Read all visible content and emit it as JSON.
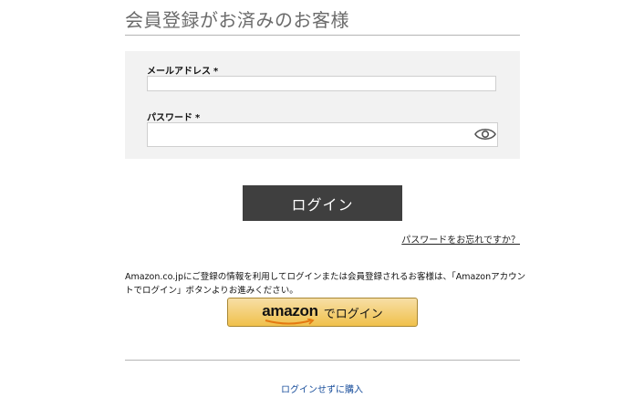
{
  "page": {
    "heading": "会員登録がお済みのお客様"
  },
  "form": {
    "email_label": "メールアドレス",
    "password_label": "パスワード",
    "required_mark": "*",
    "email_value": "",
    "password_value": ""
  },
  "login_button": "ログイン",
  "forgot_password": "パスワードをお忘れですか？",
  "amazon": {
    "description": "Amazon.co.jpにご登録の情報を利用してログインまたは会員登録されるお客様は、「Amazonアカウントでログイン」ボタンよりお進みください。",
    "logo_text": "amazon",
    "button_label": "でログイン"
  },
  "guest_link": "ログインせずに購入",
  "colors": {
    "login_button_bg": "#3f3f3f",
    "amazon_button_bg": "#f0c14b",
    "guest_link": "#1a4f9c"
  },
  "icons": {
    "password_toggle": "eye-icon"
  }
}
